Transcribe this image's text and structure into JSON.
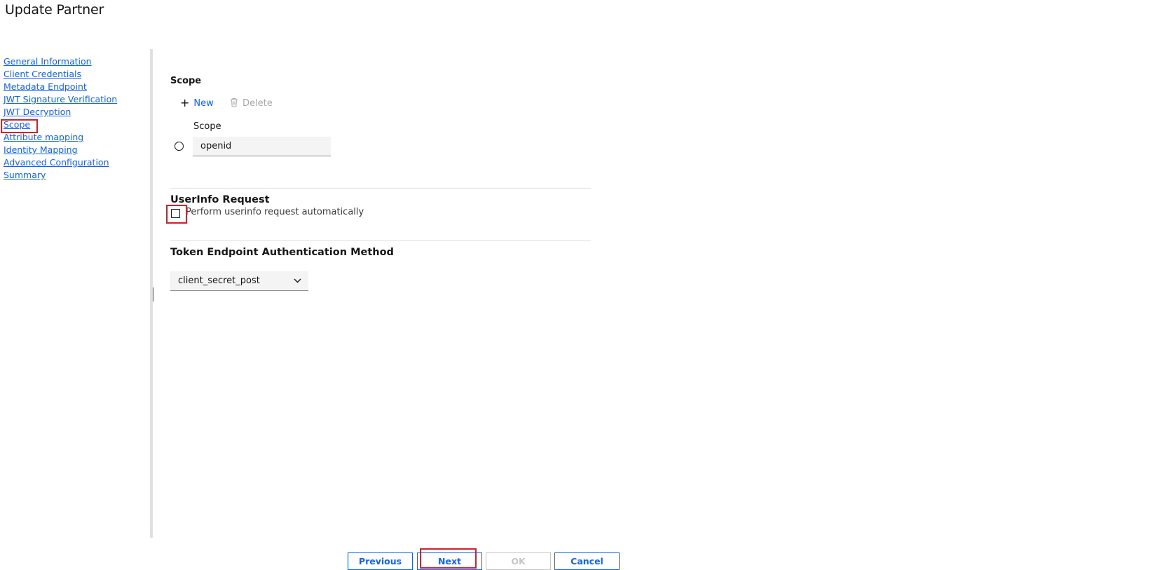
{
  "page": {
    "title": "Update Partner"
  },
  "nav": {
    "items": [
      {
        "label": "General Information"
      },
      {
        "label": "Client Credentials"
      },
      {
        "label": "Metadata Endpoint"
      },
      {
        "label": "JWT Signature Verification"
      },
      {
        "label": "JWT Decryption"
      },
      {
        "label": "Scope"
      },
      {
        "label": "Attribute mapping"
      },
      {
        "label": "Identity Mapping"
      },
      {
        "label": "Advanced Configuration"
      },
      {
        "label": "Summary"
      }
    ]
  },
  "scope": {
    "title": "Scope",
    "new_label": "New",
    "delete_label": "Delete",
    "column_label": "Scope",
    "value": "openid"
  },
  "userinfo": {
    "title": "UserInfo Request",
    "checkbox_label": "Perform userinfo request automatically"
  },
  "token": {
    "title": "Token Endpoint Authentication Method",
    "selected": "client_secret_post"
  },
  "footer": {
    "previous": "Previous",
    "next": "Next",
    "ok": "OK",
    "cancel": "Cancel"
  },
  "colors": {
    "link": "#0f62fe",
    "highlight": "#da1e28",
    "disabled": "#c6c6c6"
  }
}
